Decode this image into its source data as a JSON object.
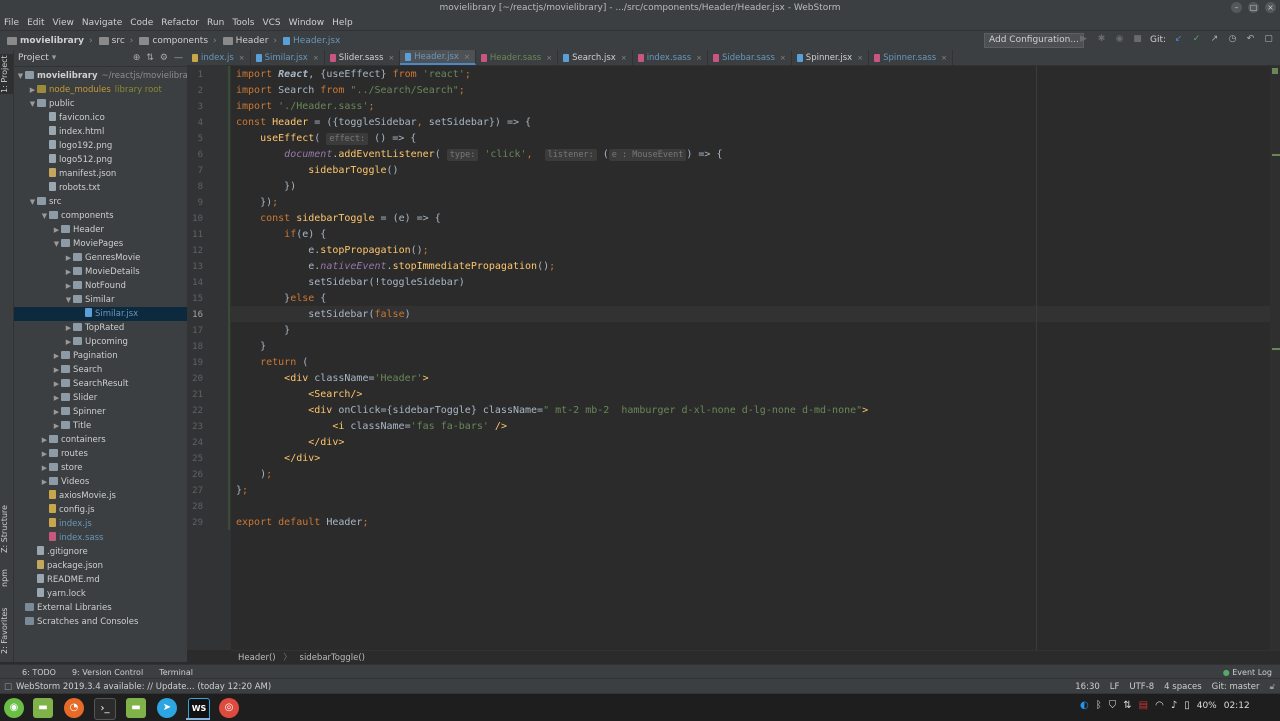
{
  "window": {
    "title": "movielibrary [~/reactjs/movielibrary] - .../src/components/Header/Header.jsx - WebStorm"
  },
  "menu": [
    "File",
    "Edit",
    "View",
    "Navigate",
    "Code",
    "Refactor",
    "Run",
    "Tools",
    "VCS",
    "Window",
    "Help"
  ],
  "nav": {
    "breadcrumbs": [
      "movielibrary",
      "src",
      "components",
      "Header",
      "Header.jsx"
    ],
    "add_configuration": "Add Configuration...",
    "git_label": "Git:"
  },
  "left_stripe": {
    "project": "1: Project",
    "structure": "Z: Structure",
    "npm": "npm",
    "favorites": "2: Favorites"
  },
  "project": {
    "header": "Project",
    "tree": [
      {
        "label": "movielibrary",
        "extra": "~/reactjs/movielibrary",
        "depth": 0,
        "arrow": "open",
        "icon": "folder",
        "bold": true
      },
      {
        "label": "node_modules",
        "extra": "library root",
        "depth": 1,
        "arrow": "closed",
        "icon": "folder",
        "excluded": true
      },
      {
        "label": "public",
        "depth": 1,
        "arrow": "open",
        "icon": "folder"
      },
      {
        "label": "favicon.ico",
        "depth": 2,
        "icon": "file"
      },
      {
        "label": "index.html",
        "depth": 2,
        "icon": "file"
      },
      {
        "label": "logo192.png",
        "depth": 2,
        "icon": "file"
      },
      {
        "label": "logo512.png",
        "depth": 2,
        "icon": "file"
      },
      {
        "label": "manifest.json",
        "depth": 2,
        "icon": "json"
      },
      {
        "label": "robots.txt",
        "depth": 2,
        "icon": "file"
      },
      {
        "label": "src",
        "depth": 1,
        "arrow": "open",
        "icon": "folder"
      },
      {
        "label": "components",
        "depth": 2,
        "arrow": "open",
        "icon": "folder"
      },
      {
        "label": "Header",
        "depth": 3,
        "arrow": "closed",
        "icon": "folder"
      },
      {
        "label": "MoviePages",
        "depth": 3,
        "arrow": "open",
        "icon": "folder"
      },
      {
        "label": "GenresMovie",
        "depth": 4,
        "arrow": "closed",
        "icon": "folder"
      },
      {
        "label": "MovieDetails",
        "depth": 4,
        "arrow": "closed",
        "icon": "folder"
      },
      {
        "label": "NotFound",
        "depth": 4,
        "arrow": "closed",
        "icon": "folder"
      },
      {
        "label": "Similar",
        "depth": 4,
        "arrow": "open",
        "icon": "folder"
      },
      {
        "label": "Similar.jsx",
        "depth": 5,
        "icon": "jsx",
        "selected": true
      },
      {
        "label": "TopRated",
        "depth": 4,
        "arrow": "closed",
        "icon": "folder"
      },
      {
        "label": "Upcoming",
        "depth": 4,
        "arrow": "closed",
        "icon": "folder"
      },
      {
        "label": "Pagination",
        "depth": 3,
        "arrow": "closed",
        "icon": "folder"
      },
      {
        "label": "Search",
        "depth": 3,
        "arrow": "closed",
        "icon": "folder"
      },
      {
        "label": "SearchResult",
        "depth": 3,
        "arrow": "closed",
        "icon": "folder"
      },
      {
        "label": "Slider",
        "depth": 3,
        "arrow": "closed",
        "icon": "folder"
      },
      {
        "label": "Spinner",
        "depth": 3,
        "arrow": "closed",
        "icon": "folder"
      },
      {
        "label": "Title",
        "depth": 3,
        "arrow": "closed",
        "icon": "folder"
      },
      {
        "label": "containers",
        "depth": 2,
        "arrow": "closed",
        "icon": "folder"
      },
      {
        "label": "routes",
        "depth": 2,
        "arrow": "closed",
        "icon": "folder"
      },
      {
        "label": "store",
        "depth": 2,
        "arrow": "closed",
        "icon": "folder"
      },
      {
        "label": "Videos",
        "depth": 2,
        "arrow": "closed",
        "icon": "folder"
      },
      {
        "label": "axiosMovie.js",
        "depth": 2,
        "icon": "js"
      },
      {
        "label": "config.js",
        "depth": 2,
        "icon": "js"
      },
      {
        "label": "index.js",
        "depth": 2,
        "icon": "js",
        "blue": true
      },
      {
        "label": "index.sass",
        "depth": 2,
        "icon": "sass",
        "blue": true
      },
      {
        "label": ".gitignore",
        "depth": 1,
        "icon": "file"
      },
      {
        "label": "package.json",
        "depth": 1,
        "icon": "json"
      },
      {
        "label": "README.md",
        "depth": 1,
        "icon": "file"
      },
      {
        "label": "yarn.lock",
        "depth": 1,
        "icon": "file"
      },
      {
        "label": "External Libraries",
        "depth": 0,
        "icon": "lib"
      },
      {
        "label": "Scratches and Consoles",
        "depth": 0,
        "icon": "lib"
      }
    ]
  },
  "tabs": [
    {
      "label": "index.js",
      "type": "js",
      "color": "#6897bb"
    },
    {
      "label": "Similar.jsx",
      "type": "jsx",
      "color": "#6897bb"
    },
    {
      "label": "Slider.sass",
      "type": "sass",
      "color": "#cfcfcf"
    },
    {
      "label": "Header.jsx",
      "type": "jsx",
      "color": "#6897bb",
      "active": true
    },
    {
      "label": "Header.sass",
      "type": "sass",
      "color": "#6a8759"
    },
    {
      "label": "Search.jsx",
      "type": "jsx",
      "color": "#cfcfcf"
    },
    {
      "label": "index.sass",
      "type": "sass",
      "color": "#6897bb"
    },
    {
      "label": "Sidebar.sass",
      "type": "sass",
      "color": "#6897bb"
    },
    {
      "label": "Spinner.jsx",
      "type": "jsx",
      "color": "#cfcfcf"
    },
    {
      "label": "Spinner.sass",
      "type": "sass",
      "color": "#6897bb"
    }
  ],
  "code_lines": [
    "<span class=\"kw\">import</span> <span class=\"cls\">React</span>, {useEffect} <span class=\"kw\">from</span> <span class=\"str\">'react'</span><span class=\"kw\">;</span>",
    "<span class=\"kw\">import</span> Search <span class=\"kw\">from</span> <span class=\"str\">\"../Search/Search\"</span><span class=\"kw\">;</span>",
    "<span class=\"kw\">import</span> <span class=\"str\">'./Header.sass'</span><span class=\"kw\">;</span>",
    "<span class=\"kw\">const</span> <span class=\"fn\">Header</span> = ({toggleSidebar<span class=\"kw\">,</span> setSidebar}) => {",
    "    <span class=\"fn\">useEffect</span>( <span class=\"hint\">effect:</span> () => {",
    "        <span class=\"var\">document</span>.<span class=\"fn\">addEventListener</span>( <span class=\"hint\">type:</span> <span class=\"str\">'click'</span><span class=\"kw\">,</span>  <span class=\"hint\">listener:</span> (<span class=\"hint\">e : MouseEvent</span>) => {",
    "            <span class=\"fn\">sidebarToggle</span>()",
    "        })",
    "    })<span class=\"kw\">;</span>",
    "    <span class=\"kw\">const</span> <span class=\"fn\">sidebarToggle</span> = (e) => {",
    "        <span class=\"kw\">if</span>(e) {",
    "            e.<span class=\"fn\">stopPropagation</span>()<span class=\"kw\">;</span>",
    "            e.<span class=\"var\">nativeEvent</span>.<span class=\"fn\">stopImmediatePropagation</span>()<span class=\"kw\">;</span>",
    "            setSidebar(!toggleSidebar)",
    "        }<span class=\"kw\">else</span> {",
    "            setSidebar(<span class=\"kw\">false</span>)",
    "        }",
    "    }",
    "    <span class=\"kw\">return</span> (",
    "        <span class=\"fn\">&lt;div</span> className=<span class=\"str\">'Header'</span><span class=\"fn\">&gt;</span>",
    "            <span class=\"fn\">&lt;Search/&gt;</span>",
    "            <span class=\"fn\">&lt;div</span> onClick={sidebarToggle} className=<span class=\"str\">\" mt-2 mb-2  hamburger d-xl-none d-lg-none d-md-none\"</span><span class=\"fn\">&gt;</span>",
    "                <span class=\"fn\">&lt;i</span> className=<span class=\"str\">'fas fa-bars'</span> <span class=\"fn\">/&gt;</span>",
    "            <span class=\"fn\">&lt;/div&gt;</span>",
    "        <span class=\"fn\">&lt;/div&gt;</span>",
    "    )<span class=\"kw\">;</span>",
    "}<span class=\"kw\">;</span>",
    "",
    "<span class=\"kw\">export default</span> Header<span class=\"kw\">;</span>"
  ],
  "current_line": 16,
  "code_breadcrumb": [
    "Header()",
    "sidebarToggle()"
  ],
  "bottom_tools": {
    "todo": "6: TODO",
    "vcs": "9: Version Control",
    "terminal": "Terminal",
    "event_log": "Event Log"
  },
  "status": {
    "message": "WebStorm 2019.3.4 available: // Update... (today 12:20 AM)",
    "position": "16:30",
    "line_sep": "LF",
    "encoding": "UTF-8",
    "indent": "4 spaces",
    "git": "Git: master"
  },
  "taskbar": {
    "battery": "40%",
    "time": "02:12"
  }
}
